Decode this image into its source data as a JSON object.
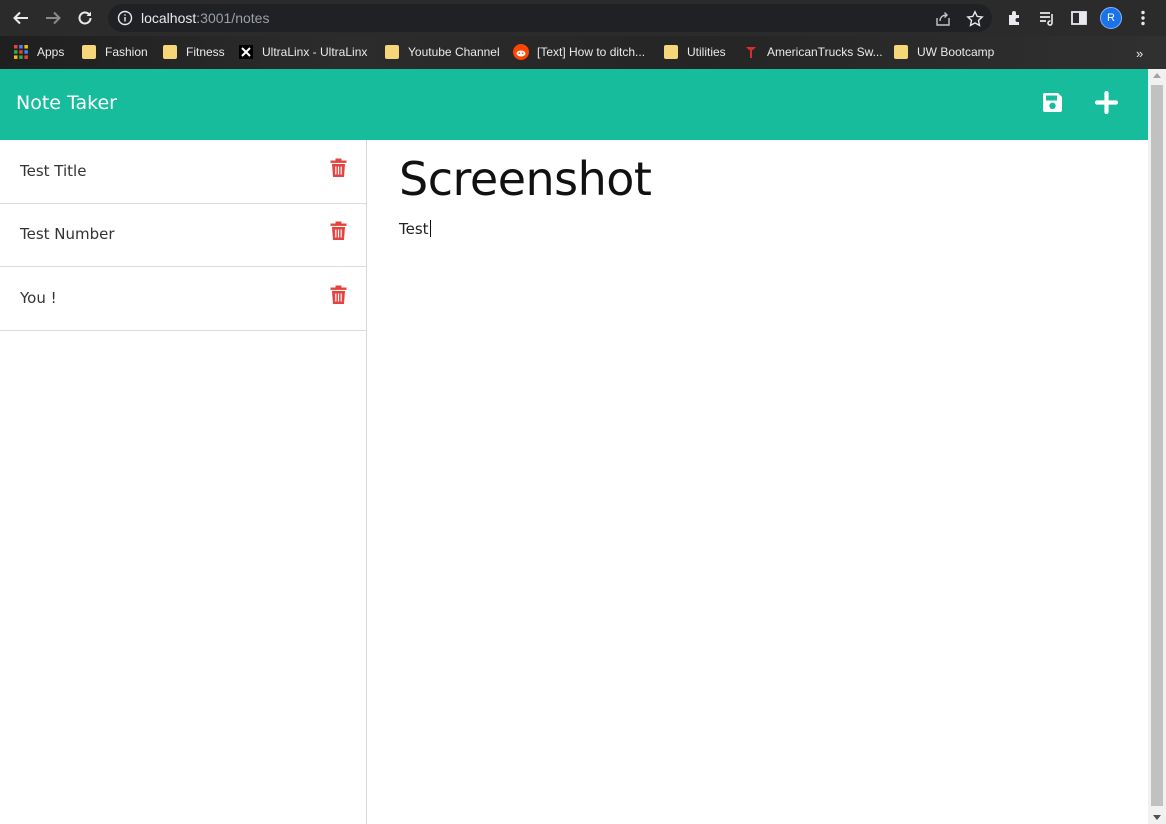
{
  "browser": {
    "url_host": "localhost",
    "url_rest": ":3001/notes",
    "profile_initial": "R",
    "bookmarks": [
      {
        "label": "Apps",
        "icon": "apps-grid-icon"
      },
      {
        "label": "Fashion",
        "icon": "folder-icon"
      },
      {
        "label": "Fitness",
        "icon": "folder-icon"
      },
      {
        "label": "UltraLinx - UltraLinx",
        "icon": "ultralinx-x-icon"
      },
      {
        "label": "Youtube Channel",
        "icon": "folder-icon"
      },
      {
        "label": "[Text] How to ditch...",
        "icon": "reddit-icon"
      },
      {
        "label": "Utilities",
        "icon": "folder-icon"
      },
      {
        "label": "AmericanTrucks Sw...",
        "icon": "americantrucks-icon"
      },
      {
        "label": "UW Bootcamp",
        "icon": "folder-icon"
      }
    ],
    "overflow_label": "»"
  },
  "app": {
    "title": "Note Taker",
    "accent_color": "#17bc9c",
    "delete_color": "#e4443f"
  },
  "notes": [
    {
      "title": "Test Title"
    },
    {
      "title": "Test Number"
    },
    {
      "title": "You !"
    }
  ],
  "editor": {
    "title": "Screenshot",
    "body": "Test"
  }
}
